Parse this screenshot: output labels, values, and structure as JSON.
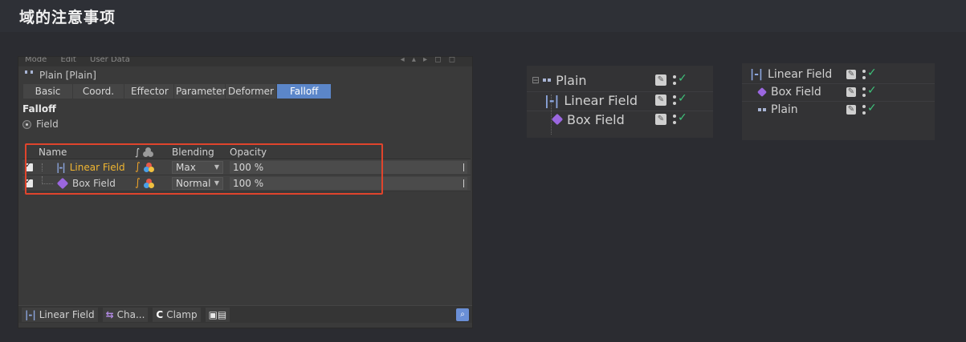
{
  "slide": {
    "title": "域的注意事项"
  },
  "attribute_manager": {
    "menubar": [
      "Mode",
      "Edit",
      "User Data"
    ],
    "object_title": "Plain [Plain]",
    "tabs": [
      {
        "label": "Basic",
        "active": false
      },
      {
        "label": "Coord.",
        "active": false
      },
      {
        "label": "Effector",
        "active": false
      },
      {
        "label": "Parameter",
        "active": false
      },
      {
        "label": "Deformer",
        "active": false
      },
      {
        "label": "Falloff",
        "active": true
      }
    ],
    "section_label": "Falloff",
    "field_radio_label": "Field",
    "field_list": {
      "headers": {
        "name": "Name",
        "blending": "Blending",
        "opacity": "Opacity"
      },
      "rows": [
        {
          "name": "Linear Field",
          "blending": "Max",
          "opacity": "100 %",
          "enabled": true,
          "selected": true,
          "icon": "linear-field-icon"
        },
        {
          "name": "Box Field",
          "blending": "Normal",
          "opacity": "100 %",
          "enabled": true,
          "selected": false,
          "icon": "box-field-icon"
        }
      ]
    },
    "bottom_bar": {
      "linear_field": "Linear Field",
      "channel": "Cha...",
      "clamp": "Clamp",
      "clamp_glyph": "C"
    }
  },
  "object_manager_1": {
    "rows": [
      {
        "label": "Plain",
        "icon": "plain-icon"
      },
      {
        "label": "Linear Field",
        "icon": "linear-field-icon"
      },
      {
        "label": "Box Field",
        "icon": "box-field-icon"
      }
    ]
  },
  "object_manager_2": {
    "rows": [
      {
        "label": "Linear Field",
        "icon": "linear-field-icon"
      },
      {
        "label": "Box Field",
        "icon": "box-field-icon"
      },
      {
        "label": "Plain",
        "icon": "plain-icon"
      }
    ]
  },
  "colors": {
    "active_tab": "#5b86c9",
    "highlight_border": "#e0442c",
    "selected_field_name": "#f0b530",
    "check_green": "#3fc37b",
    "box_field_purple": "#9b67e0"
  }
}
